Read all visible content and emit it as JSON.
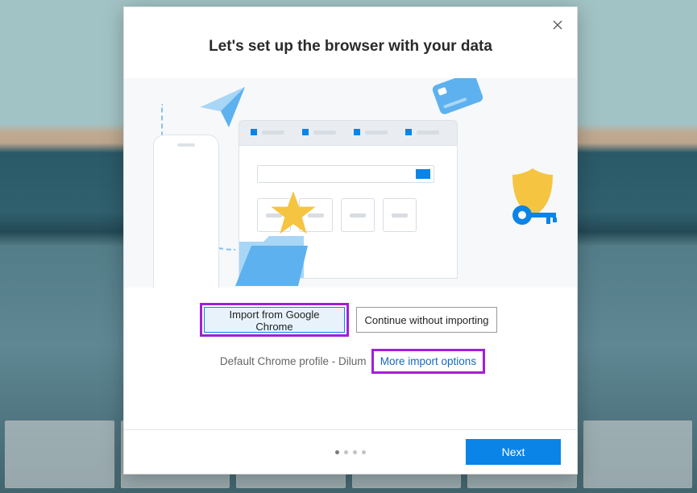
{
  "dialog": {
    "title": "Let's set up the browser with your data",
    "buttons": {
      "import": "Import from Google Chrome",
      "skip": "Continue without importing"
    },
    "profile_prefix": "Default Chrome profile - ",
    "profile_name": "Dilum",
    "more_options": "More import options",
    "next": "Next"
  }
}
